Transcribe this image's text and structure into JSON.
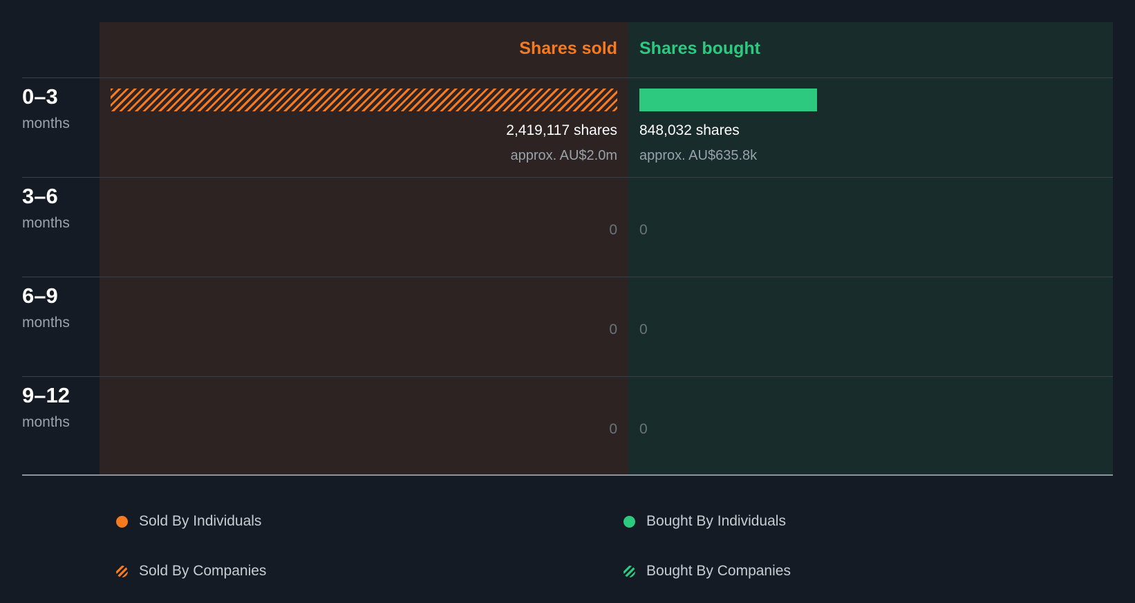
{
  "colors": {
    "sold": "#f57a20",
    "bought": "#2dc97f",
    "background": "#151b24",
    "sold_panel": "#2d2322",
    "bought_panel": "#172c2b"
  },
  "headers": {
    "sold": "Shares sold",
    "bought": "Shares bought"
  },
  "chart_data": {
    "type": "bar",
    "orientation": "horizontal-diverging",
    "categories": [
      "0–3 months",
      "3–6 months",
      "6–9 months",
      "9–12 months"
    ],
    "series": [
      {
        "name": "Sold By Companies",
        "side": "sold",
        "pattern": "hatched",
        "values": [
          2419117,
          0,
          0,
          0
        ]
      },
      {
        "name": "Sold By Individuals",
        "side": "sold",
        "pattern": "solid",
        "values": [
          0,
          0,
          0,
          0
        ]
      },
      {
        "name": "Bought By Individuals",
        "side": "bought",
        "pattern": "solid",
        "values": [
          848032,
          0,
          0,
          0
        ]
      },
      {
        "name": "Bought By Companies",
        "side": "bought",
        "pattern": "hatched",
        "values": [
          0,
          0,
          0,
          0
        ]
      }
    ],
    "sold_max": 2419117
  },
  "rows": [
    {
      "range": "0–3",
      "unit": "months",
      "sold_shares": "2,419,117 shares",
      "sold_value": "approx. AU$2.0m",
      "bought_shares": "848,032 shares",
      "bought_value": "approx. AU$635.8k"
    },
    {
      "range": "3–6",
      "unit": "months",
      "sold_zero": "0",
      "bought_zero": "0"
    },
    {
      "range": "6–9",
      "unit": "months",
      "sold_zero": "0",
      "bought_zero": "0"
    },
    {
      "range": "9–12",
      "unit": "months",
      "sold_zero": "0",
      "bought_zero": "0"
    }
  ],
  "legend": [
    {
      "label": "Sold By Individuals",
      "color": "#f57a20",
      "pattern": "solid"
    },
    {
      "label": "Bought By Individuals",
      "color": "#2dc97f",
      "pattern": "solid"
    },
    {
      "label": "Sold By Companies",
      "color": "#f57a20",
      "pattern": "hatched"
    },
    {
      "label": "Bought By Companies",
      "color": "#2dc97f",
      "pattern": "hatched"
    }
  ]
}
